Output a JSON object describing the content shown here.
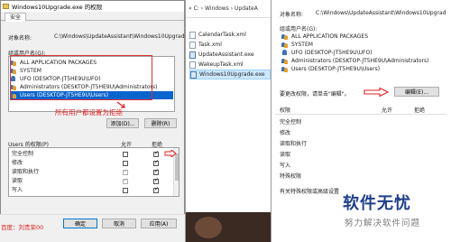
{
  "perm_dialog": {
    "title": "Windows10Upgrade.exe 的权限",
    "tab": "安全",
    "object_label": "对象名称:",
    "object_value": "C:\\Windows\\UpdateAssistant\\Windows10Upgrad",
    "groups_label": "组或用户名(G):",
    "users": [
      "ALL APPLICATION PACKAGES",
      "SYSTEM",
      "UFO (DESKTOP-JT5HE9U\\UFO)",
      "Administrators (DESKTOP-JT5HE9U\\Administrators)",
      "Users (DESKTOP-JT5HE9U\\Users)"
    ],
    "selected_user_index": 4,
    "annotation": "所有用户都设置为拒绝",
    "add_button": "添加(D)...",
    "remove_button": "删除(R)",
    "perm_label": "Users 的权限(P)",
    "allow_label": "允许",
    "deny_label": "拒绝",
    "permissions": [
      {
        "name": "完全控制",
        "allow": false,
        "deny": true,
        "dim": false
      },
      {
        "name": "修改",
        "allow": false,
        "deny": true,
        "dim": false
      },
      {
        "name": "读取和执行",
        "allow": true,
        "deny": true,
        "dim": true
      },
      {
        "name": "读取",
        "allow": true,
        "deny": true,
        "dim": true
      },
      {
        "name": "写入",
        "allow": false,
        "deny": true,
        "dim": false
      }
    ],
    "ok_button": "确定",
    "cancel_button": "取消",
    "apply_button": "应用(A)",
    "watermark": "百度：刘贵荣00"
  },
  "explorer": {
    "breadcrumb": "« C: › Windows › UpdateA",
    "files": [
      {
        "name": "CalendarTask.xml",
        "type": "xml"
      },
      {
        "name": "Task.xml",
        "type": "xml"
      },
      {
        "name": "UpdateAssistant.exe",
        "type": "exe"
      },
      {
        "name": "WakeupTask.xml",
        "type": "xml"
      },
      {
        "name": "Windows10Upgrade.exe",
        "type": "exe"
      }
    ],
    "selected_index": 4
  },
  "security_dialog": {
    "object_label": "对象名称:",
    "object_value": "C:\\Windows\\UpdateAssistant\\Windows10Upgrad",
    "groups_label": "组或用户名(G):",
    "users": [
      "ALL APPLICATION PACKAGES",
      "SYSTEM",
      "UFO (DESKTOP-JT5HE9U\\UFO)",
      "Administrators (DESKTOP-JT5HE9U\\Administrators)",
      "Users (DESKTOP-JT5HE9U\\Users)"
    ],
    "change_hint": "要更改权限，请单击\"编辑\"。",
    "edit_button": "编辑(E)...",
    "perm_label": "权限",
    "allow_label": "允许",
    "deny_label": "拒绝",
    "permissions": [
      "完全控制",
      "修改",
      "读取和执行",
      "读取",
      "写入",
      "特殊权限"
    ],
    "advanced_hint": "有关特殊权限或高级设置"
  },
  "brand": {
    "main": "软件无忧",
    "sub": "努力解决软件问题"
  },
  "colors": {
    "annotation_red": "#e02020",
    "selection_blue": "#0a64cd",
    "brand_blue": "#1e3f8a"
  }
}
